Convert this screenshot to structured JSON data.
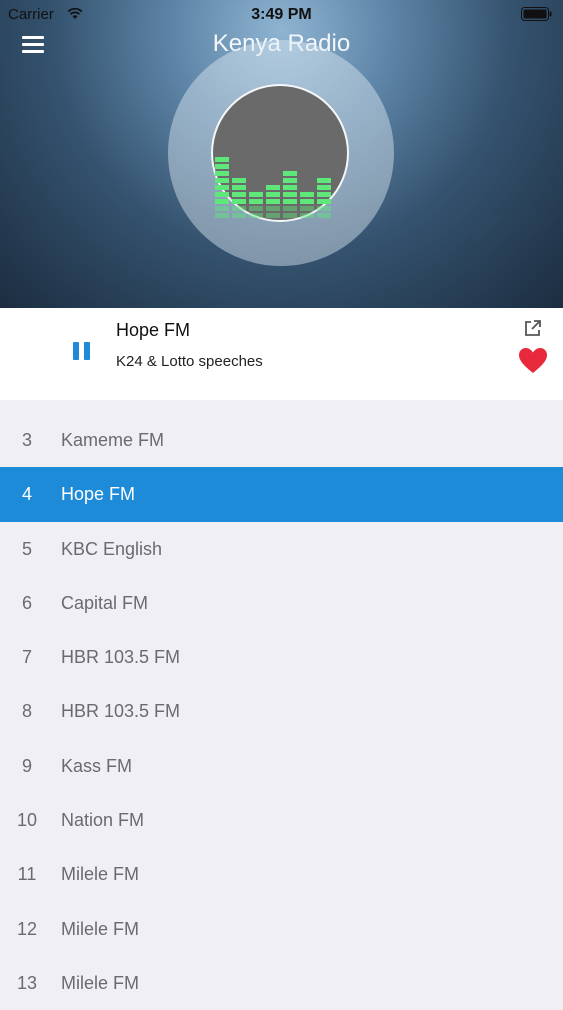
{
  "status_bar": {
    "carrier": "Carrier",
    "time": "3:49 PM"
  },
  "header": {
    "title": "Kenya Radio",
    "menu_icon": "hamburger-menu-icon",
    "artwork_icon": "equalizer-icon"
  },
  "now_playing": {
    "title": "Hope FM",
    "subtitle": "K24 & Lotto speeches",
    "state_icon": "pause-icon",
    "share_icon": "share-external-icon",
    "favorite_icon": "heart-icon",
    "favorited": true
  },
  "stations": [
    {
      "num": "3",
      "name": "Kameme FM",
      "selected": false
    },
    {
      "num": "4",
      "name": "Hope FM",
      "selected": true
    },
    {
      "num": "5",
      "name": "KBC English",
      "selected": false
    },
    {
      "num": "6",
      "name": "Capital FM",
      "selected": false
    },
    {
      "num": "7",
      "name": "HBR 103.5 FM",
      "selected": false
    },
    {
      "num": "8",
      "name": "HBR 103.5 FM",
      "selected": false
    },
    {
      "num": "9",
      "name": "Kass FM",
      "selected": false
    },
    {
      "num": "10",
      "name": "Nation FM",
      "selected": false
    },
    {
      "num": "11",
      "name": "Milele FM",
      "selected": false
    },
    {
      "num": "12",
      "name": "Milele FM",
      "selected": false
    },
    {
      "num": "13",
      "name": "Milele FM",
      "selected": false
    }
  ],
  "colors": {
    "accent": "#1e8bd8",
    "favorite": "#e8293b",
    "equalizer": "#5ee87a",
    "list_text": "#6b6b6f"
  }
}
